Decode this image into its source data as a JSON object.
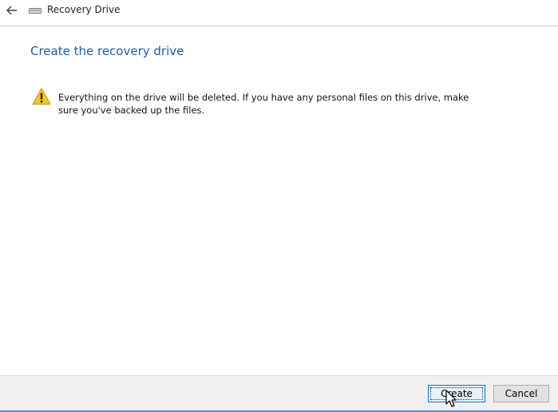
{
  "titlebar": {
    "back_icon": "back-arrow-icon",
    "drive_icon": "drive-icon",
    "title": "Recovery Drive"
  },
  "main": {
    "heading": "Create the recovery drive",
    "warning": {
      "icon": "warning-icon",
      "text": "Everything on the drive will be deleted. If you have any personal files on this drive, make sure you've backed up the files."
    }
  },
  "footer": {
    "create_label": "Create",
    "cancel_label": "Cancel"
  },
  "colors": {
    "heading": "#1f5aa8",
    "footer_bg": "#f0f0f0",
    "default_button_border": "#0078d7",
    "warning_yellow": "#f4c430"
  }
}
